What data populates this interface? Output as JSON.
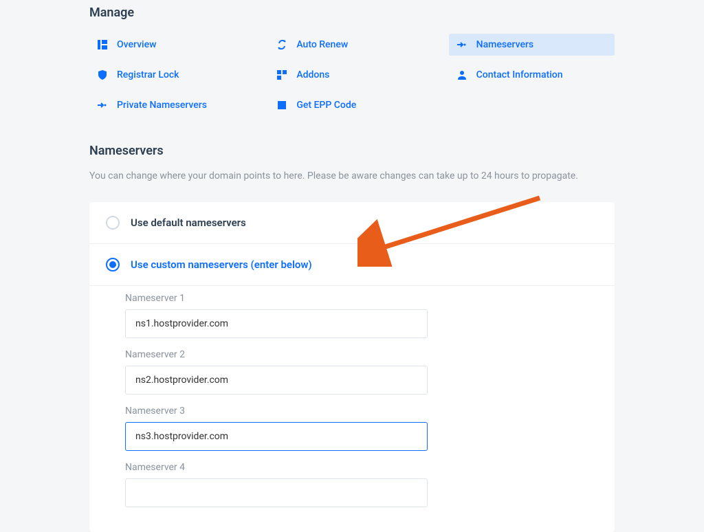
{
  "manage": {
    "title": "Manage",
    "items": [
      {
        "label": "Overview",
        "icon": "overview"
      },
      {
        "label": "Auto Renew",
        "icon": "refresh"
      },
      {
        "label": "Nameservers",
        "icon": "share",
        "active": true
      },
      {
        "label": "Registrar Lock",
        "icon": "shield"
      },
      {
        "label": "Addons",
        "icon": "grid"
      },
      {
        "label": "Contact Information",
        "icon": "person"
      },
      {
        "label": "Private Nameservers",
        "icon": "share"
      },
      {
        "label": "Get EPP Code",
        "icon": "square"
      }
    ]
  },
  "page": {
    "title": "Nameservers",
    "description": "You can change where your domain points to here. Please be aware changes can take up to 24 hours to propagate."
  },
  "radios": {
    "default_label": "Use default nameservers",
    "custom_label": "Use custom nameservers (enter below)",
    "selected": "custom"
  },
  "fields": [
    {
      "label": "Nameserver 1",
      "value": "ns1.hostprovider.com"
    },
    {
      "label": "Nameserver 2",
      "value": "ns2.hostprovider.com"
    },
    {
      "label": "Nameserver 3",
      "value": "ns3.hostprovider.com",
      "focused": true
    },
    {
      "label": "Nameserver 4",
      "value": ""
    }
  ]
}
